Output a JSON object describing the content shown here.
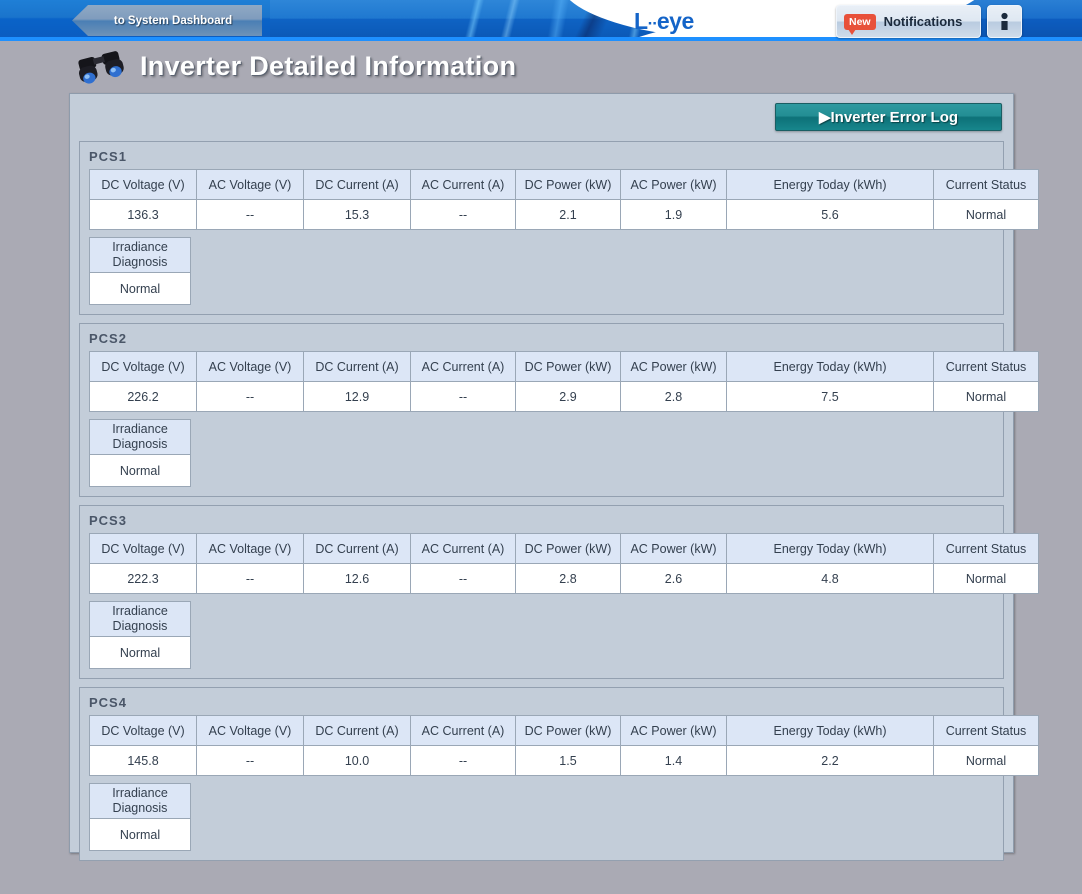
{
  "header": {
    "dashboard_button_label": "to System Dashboard",
    "logo_text": "L",
    "logo_dots": "··",
    "logo_text2": "eye",
    "notifications_badge": "New",
    "notifications_label": "Notifications",
    "user_icon_name": "person-icon"
  },
  "page": {
    "title": "Inverter Detailed Information",
    "title_icon": "binoculars-icon"
  },
  "toolbar": {
    "error_log_label": "▶Inverter Error Log"
  },
  "table": {
    "columns": [
      "DC Voltage (V)",
      "AC Voltage (V)",
      "DC Current (A)",
      "AC Current (A)",
      "DC Power (kW)",
      "AC Power (kW)",
      "Energy Today (kWh)",
      "Current Status"
    ],
    "irradiance_header": "Irradiance Diagnosis",
    "irradiance_header_line1": "Irradiance",
    "irradiance_header_line2": "Diagnosis"
  },
  "pcs_units": [
    {
      "name": "PCS1",
      "values": [
        "136.3",
        "--",
        "15.3",
        "--",
        "2.1",
        "1.9",
        "5.6",
        "Normal"
      ],
      "irradiance_diagnosis": "Normal"
    },
    {
      "name": "PCS2",
      "values": [
        "226.2",
        "--",
        "12.9",
        "--",
        "2.9",
        "2.8",
        "7.5",
        "Normal"
      ],
      "irradiance_diagnosis": "Normal"
    },
    {
      "name": "PCS3",
      "values": [
        "222.3",
        "--",
        "12.6",
        "--",
        "2.8",
        "2.6",
        "4.8",
        "Normal"
      ],
      "irradiance_diagnosis": "Normal"
    },
    {
      "name": "PCS4",
      "values": [
        "145.8",
        "--",
        "10.0",
        "--",
        "1.5",
        "1.4",
        "2.2",
        "Normal"
      ],
      "irradiance_diagnosis": "Normal"
    }
  ],
  "colors": {
    "page_background": "#aaaab4",
    "panel_background": "#c3cdd9",
    "header_blue": "#0b5cc0",
    "accent_line": "#1e90ff",
    "table_header": "#dce6f6",
    "error_log_teal": "#17868c",
    "badge_red": "#e8513a",
    "logo_blue": "#1464c8"
  }
}
